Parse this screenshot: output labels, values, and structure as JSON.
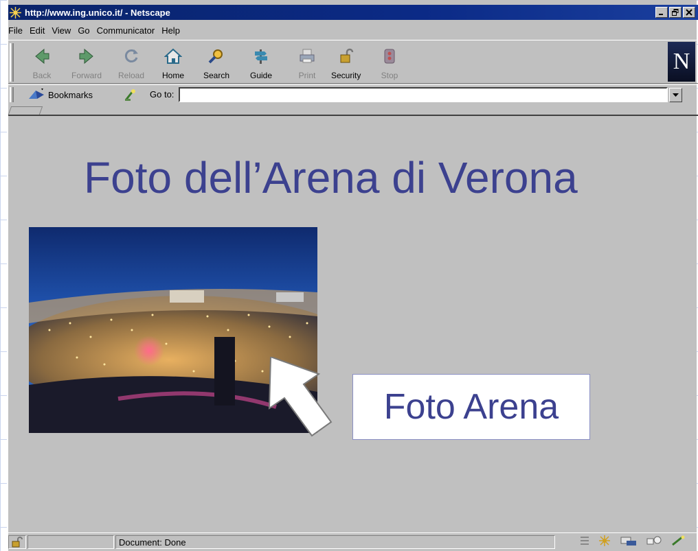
{
  "window": {
    "title": "http://www.ing.unico.it/ - Netscape",
    "buttons": [
      "minimize",
      "restore",
      "close"
    ]
  },
  "menu": {
    "items": [
      "File",
      "Edit",
      "View",
      "Go",
      "Communicator",
      "Help"
    ]
  },
  "toolbar": {
    "buttons": [
      {
        "label": "Back",
        "icon": "back-arrow-icon",
        "enabled": false
      },
      {
        "label": "Forward",
        "icon": "forward-arrow-icon",
        "enabled": false
      },
      {
        "label": "Reload",
        "icon": "reload-icon",
        "enabled": false
      },
      {
        "label": "Home",
        "icon": "home-icon",
        "enabled": true
      },
      {
        "label": "Search",
        "icon": "search-icon",
        "enabled": true
      },
      {
        "label": "Guide",
        "icon": "guide-icon",
        "enabled": true
      },
      {
        "label": "Print",
        "icon": "print-icon",
        "enabled": false
      },
      {
        "label": "Security",
        "icon": "lock-icon",
        "enabled": true
      },
      {
        "label": "Stop",
        "icon": "stop-icon",
        "enabled": false
      }
    ],
    "logo_letter": "N"
  },
  "location": {
    "bookmarks_label": "Bookmarks",
    "goto_label": "Go to:",
    "url_value": ""
  },
  "page": {
    "title": "Foto dell’Arena di Verona",
    "caption": "Foto Arena"
  },
  "status": {
    "text": "Document: Done"
  },
  "colors": {
    "title_text": "#3c418f",
    "titlebar": "#0a246a",
    "chrome": "#c0c0c0"
  }
}
